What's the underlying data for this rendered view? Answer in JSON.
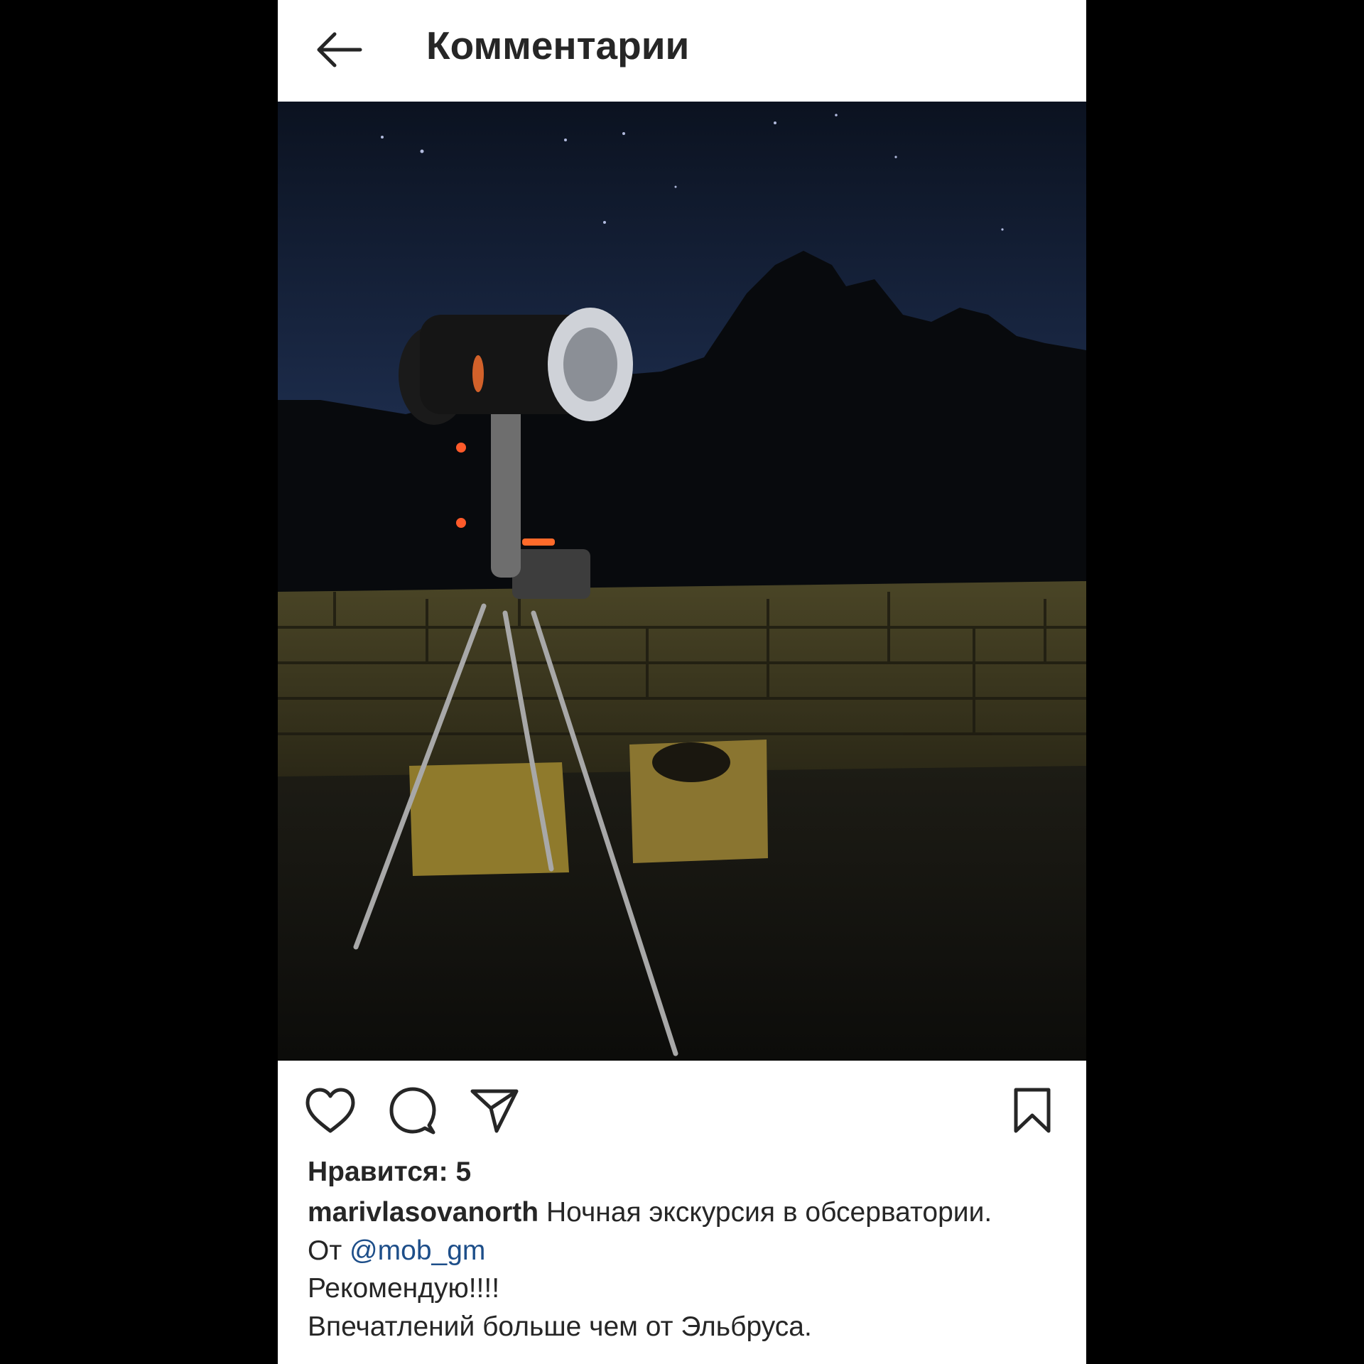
{
  "header": {
    "back_icon": "arrow-left-icon",
    "title": "Комментарии"
  },
  "post": {
    "image_alt": "",
    "actions": {
      "like_icon": "heart-icon",
      "comment_icon": "comment-bubble-icon",
      "share_icon": "paper-plane-icon",
      "save_icon": "bookmark-icon"
    },
    "likes_label": "Нравится: 5",
    "caption": {
      "username": "marivlasovanorth",
      "text_line1": "Ночная экскурсия в обсерватории.",
      "from_prefix": "От",
      "mention": "@mob_gm",
      "text_line3": "Рекомендую!!!!",
      "text_line4": "Впечатлений больше чем от Эльбруса."
    }
  },
  "colors": {
    "background": "#000000",
    "surface": "#ffffff",
    "text": "#262626",
    "mention": "#1d4e89"
  }
}
